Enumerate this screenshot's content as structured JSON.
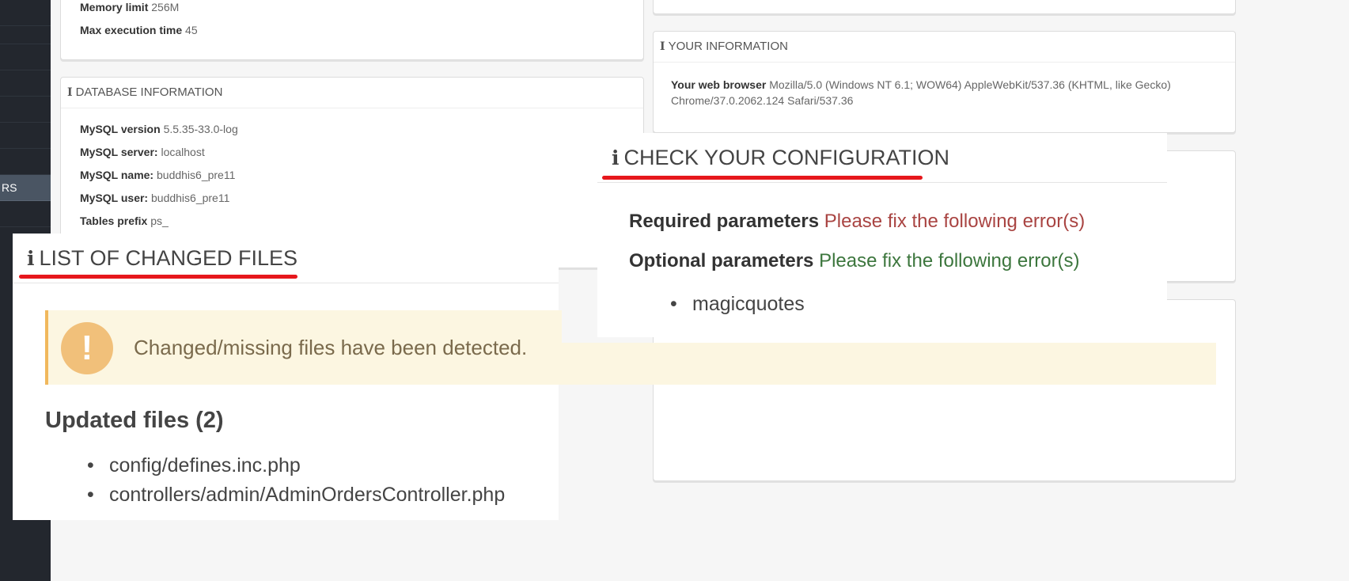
{
  "sidebar": {
    "active_label": "RS"
  },
  "server_panel": {
    "memory_label": "Memory limit",
    "memory_value": "256M",
    "max_exec_label": "Max execution time",
    "max_exec_value": "45"
  },
  "database_panel": {
    "title": "DATABASE INFORMATION",
    "rows": [
      {
        "label": "MySQL version",
        "value": "5.5.35-33.0-log"
      },
      {
        "label": "MySQL server:",
        "value": "localhost"
      },
      {
        "label": "MySQL name:",
        "value": "buddhis6_pre11"
      },
      {
        "label": "MySQL user:",
        "value": "buddhis6_pre11"
      },
      {
        "label": "Tables prefix",
        "value": "ps_"
      }
    ]
  },
  "your_info_panel": {
    "title": "YOUR INFORMATION",
    "browser_label": "Your web browser",
    "browser_value_line1": "Mozilla/5.0 (Windows NT 6.1; WOW64) AppleWebKit/537.36 (KHTML, like Gecko)",
    "browser_value_line2": "Chrome/37.0.2062.124 Safari/537.36"
  },
  "check_config": {
    "title": "CHECK YOUR CONFIGURATION",
    "required_label": "Required parameters",
    "required_value": "Please fix the following error(s)",
    "optional_label": "Optional parameters",
    "optional_value": "Please fix the following error(s)",
    "optional_items": [
      "magicquotes"
    ],
    "colors": {
      "error": "#a94442",
      "ok": "#3c763d"
    }
  },
  "changed_files": {
    "title": "LIST OF CHANGED FILES",
    "warning_text": "Changed/missing files have been detected.",
    "updated_heading": "Updated files (2)",
    "files": [
      "config/defines.inc.php",
      "controllers/admin/AdminOrdersController.php"
    ]
  },
  "colors": {
    "highlight_underline": "#e6171c",
    "warning_bg": "#fcf6e1",
    "warning_icon": "#f1c07a"
  }
}
